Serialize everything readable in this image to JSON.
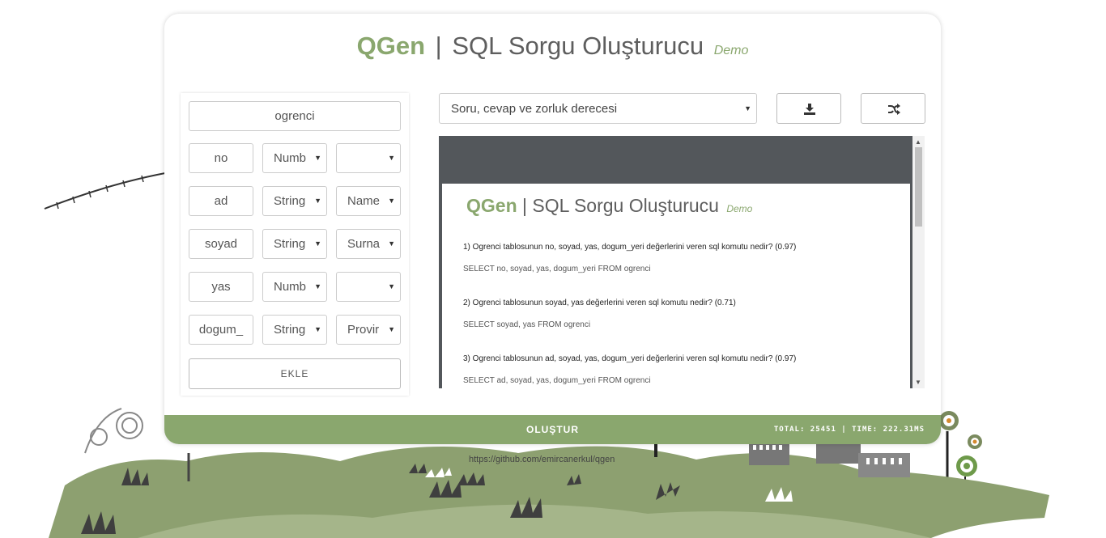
{
  "app": {
    "brand": "QGen",
    "separator": "|",
    "subtitle": "SQL Sorgu Oluşturucu",
    "badge": "Demo"
  },
  "form": {
    "table_name": "ogrenci",
    "rows": [
      {
        "name": "no",
        "type": "Numb",
        "generator": ""
      },
      {
        "name": "ad",
        "type": "String",
        "generator": "Name"
      },
      {
        "name": "soyad",
        "type": "String",
        "generator": "Surna"
      },
      {
        "name": "yas",
        "type": "Numb",
        "generator": ""
      },
      {
        "name": "dogum_",
        "type": "String",
        "generator": "Provir"
      }
    ],
    "add_label": "EKLE"
  },
  "toolbar": {
    "mode": "Soru, cevap ve zorluk derecesi",
    "download_icon": "download-icon",
    "shuffle_icon": "shuffle-icon"
  },
  "preview": {
    "questions": [
      {
        "q": "1) Ogrenci tablosunun no, soyad, yas, dogum_yeri değerlerini veren sql komutu nedir?  (0.97)",
        "a": "SELECT no, soyad, yas, dogum_yeri FROM ogrenci"
      },
      {
        "q": "2) Ogrenci tablosunun soyad, yas değerlerini veren sql komutu nedir?  (0.71)",
        "a": "SELECT soyad, yas FROM ogrenci"
      },
      {
        "q": "3) Ogrenci tablosunun ad, soyad, yas, dogum_yeri değerlerini veren sql komutu nedir?  (0.97)",
        "a": "SELECT ad, soyad, yas, dogum_yeri FROM ogrenci"
      }
    ]
  },
  "footer": {
    "create_label": "OLUŞTUR",
    "stats": "TOTAL: 25451 | TIME: 222.31MS"
  },
  "link": "https://github.com/emircanerkul/qgen",
  "colors": {
    "accent": "#8aa76e",
    "preview_bg": "#53575b",
    "text": "#5e5e5e"
  }
}
